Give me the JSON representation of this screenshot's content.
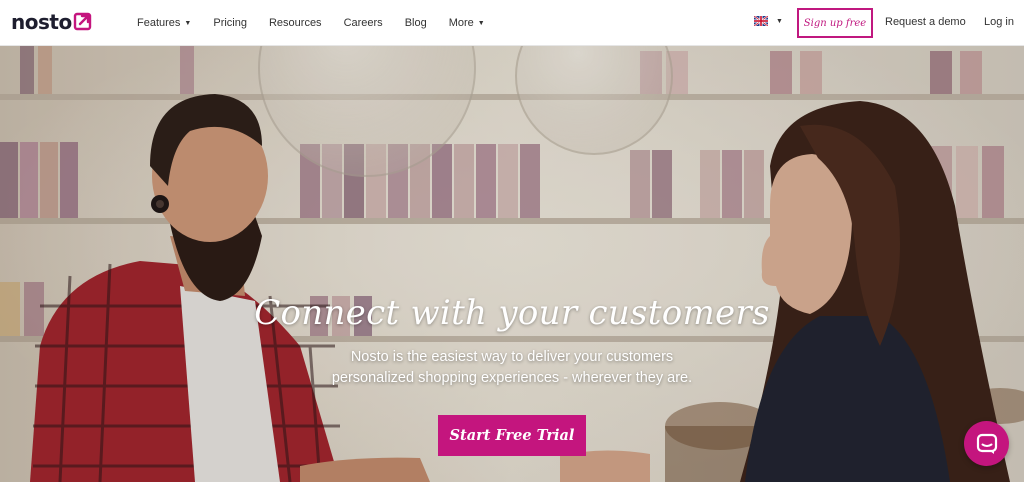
{
  "brand": {
    "logo_text": "nosto",
    "accent": "#c4157e"
  },
  "nav": {
    "items": [
      {
        "label": "Features",
        "dropdown": true
      },
      {
        "label": "Pricing",
        "dropdown": false
      },
      {
        "label": "Resources",
        "dropdown": false
      },
      {
        "label": "Careers",
        "dropdown": false
      },
      {
        "label": "Blog",
        "dropdown": false
      },
      {
        "label": "More",
        "dropdown": true
      }
    ],
    "language_icon": "uk-flag-icon",
    "signup_label": "Sign up free",
    "demo_label": "Request a demo",
    "login_label": "Log in"
  },
  "hero": {
    "headline": "Connect with your customers",
    "subline_1": "Nosto is the easiest way to deliver your customers",
    "subline_2": "personalized shopping experiences - wherever they are.",
    "cta_label": "Start Free Trial"
  },
  "chat": {
    "icon": "chat-bubble-icon"
  }
}
